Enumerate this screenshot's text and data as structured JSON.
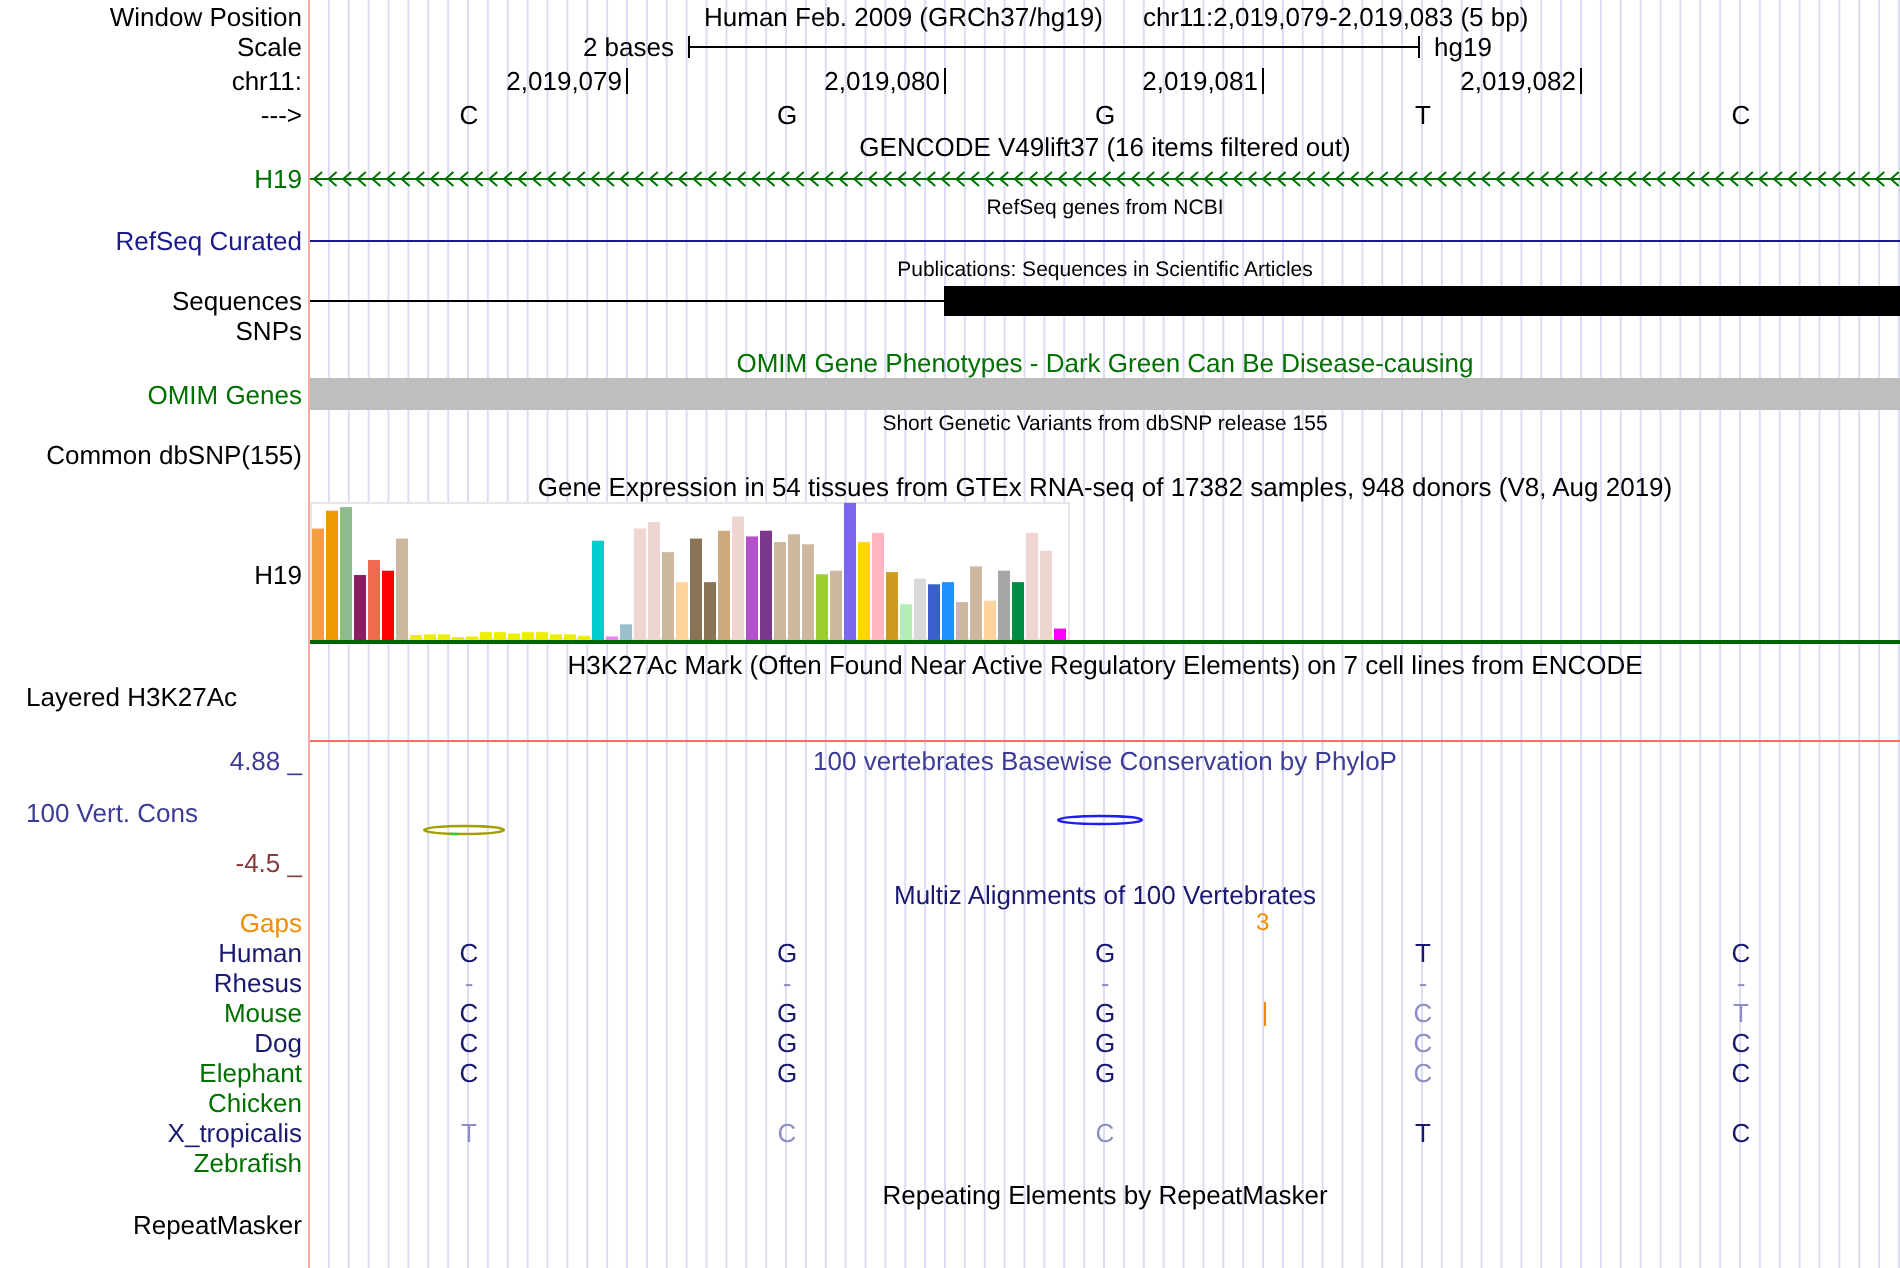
{
  "window_position": {
    "label": "Window Position",
    "assembly": "Human Feb. 2009 (GRCh37/hg19)",
    "range": "chr11:2,019,079-2,019,083 (5 bp)"
  },
  "scale": {
    "label": "Scale",
    "span": "2 bases",
    "assembly": "hg19"
  },
  "ruler": {
    "label": "chr11:",
    "positions": [
      "2,019,079",
      "2,019,080",
      "2,019,081",
      "2,019,082"
    ]
  },
  "sequence": {
    "label": "--->",
    "bases": [
      "C",
      "G",
      "G",
      "T",
      "C"
    ]
  },
  "tracks": [
    {
      "kind": "gene",
      "title": "GENCODE V49lift37 (16 items filtered out)",
      "compact": false,
      "labels": [
        "H19"
      ],
      "color": "#007000",
      "title_colored": false
    },
    {
      "kind": "line",
      "title": "RefSeq genes from NCBI",
      "compact": true,
      "labels": [
        "RefSeq Curated"
      ],
      "color": "#1a1a8c",
      "title_colored": false
    },
    {
      "kind": "publications",
      "title": "Publications: Sequences in Scientific Articles",
      "compact": true,
      "labels": [
        "Sequences",
        "SNPs"
      ],
      "color": "#000000",
      "title_colored": false
    },
    {
      "kind": "phenotype",
      "title": "OMIM Gene Phenotypes - Dark Green Can Be Disease-causing",
      "compact": false,
      "labels": [
        "OMIM Genes"
      ],
      "color": "#007000",
      "title_colored": true
    },
    {
      "kind": "empty",
      "title": "Short Genetic Variants from dbSNP release 155",
      "compact": true,
      "labels": [
        "Common dbSNP(155)"
      ],
      "color": "#000000",
      "title_colored": false
    },
    {
      "kind": "expression",
      "title": "Gene Expression in 54 tissues from GTEx RNA-seq of 17382 samples, 948 donors (V8, Aug 2019)",
      "compact": false,
      "labels": [
        "H19"
      ],
      "color": "#000000",
      "title_colored": false
    },
    {
      "kind": "signal",
      "title": "H3K27Ac Mark (Often Found Near Active Regulatory Elements) on 7 cell lines from ENCODE",
      "compact": false,
      "labels": [
        "Layered H3K27Ac"
      ],
      "color": "#000000",
      "title_colored": false
    },
    {
      "kind": "conservation",
      "title": "100 vertebrates Basewise Conservation by PhyloP",
      "compact": false,
      "labels": [
        "100 Vert. Cons"
      ],
      "max": "4.88 _",
      "min": "-4.5 _",
      "color": "#3c3c96",
      "title_colored": true
    },
    {
      "kind": "alignment",
      "title": "Multiz Alignments of 100 Vertebrates",
      "compact": false,
      "color": "#191970",
      "title_colored": true,
      "gaps": {
        "label": "Gaps",
        "count": "3"
      },
      "species": [
        {
          "name": "Human",
          "color": "#191970",
          "insertion": false,
          "bases": [
            {
              "base": "C",
              "faint": false
            },
            {
              "base": "G",
              "faint": false
            },
            {
              "base": "G",
              "faint": false
            },
            {
              "base": "T",
              "faint": false
            },
            {
              "base": "C",
              "faint": false
            }
          ]
        },
        {
          "name": "Rhesus",
          "color": "#191970",
          "insertion": false,
          "bases": [
            {
              "base": "-",
              "faint": true
            },
            {
              "base": "-",
              "faint": true
            },
            {
              "base": "-",
              "faint": true
            },
            {
              "base": "-",
              "faint": true
            },
            {
              "base": "-",
              "faint": true
            }
          ]
        },
        {
          "name": "Mouse",
          "color": "#007000",
          "insertion": true,
          "bases": [
            {
              "base": "C",
              "faint": false
            },
            {
              "base": "G",
              "faint": false
            },
            {
              "base": "G",
              "faint": false
            },
            {
              "base": "C",
              "faint": true
            },
            {
              "base": "T",
              "faint": true
            }
          ]
        },
        {
          "name": "Dog",
          "color": "#191970",
          "insertion": false,
          "bases": [
            {
              "base": "C",
              "faint": false
            },
            {
              "base": "G",
              "faint": false
            },
            {
              "base": "G",
              "faint": false
            },
            {
              "base": "C",
              "faint": true
            },
            {
              "base": "C",
              "faint": false
            }
          ]
        },
        {
          "name": "Elephant",
          "color": "#007000",
          "insertion": false,
          "bases": [
            {
              "base": "C",
              "faint": false
            },
            {
              "base": "G",
              "faint": false
            },
            {
              "base": "G",
              "faint": false
            },
            {
              "base": "C",
              "faint": true
            },
            {
              "base": "C",
              "faint": false
            }
          ]
        },
        {
          "name": "Chicken",
          "color": "#007000",
          "insertion": false
        },
        {
          "name": "X_tropicalis",
          "color": "#191970",
          "insertion": false,
          "bases": [
            {
              "base": "T",
              "faint": true
            },
            {
              "base": "C",
              "faint": true
            },
            {
              "base": "C",
              "faint": true
            },
            {
              "base": "T",
              "faint": false
            },
            {
              "base": "C",
              "faint": false
            }
          ]
        },
        {
          "name": "Zebrafish",
          "color": "#007000",
          "insertion": false
        }
      ]
    },
    {
      "kind": "empty",
      "title": "Repeating Elements by RepeatMasker",
      "compact": false,
      "labels": [
        "RepeatMasker"
      ],
      "color": "#000000",
      "title_colored": false
    }
  ]
}
